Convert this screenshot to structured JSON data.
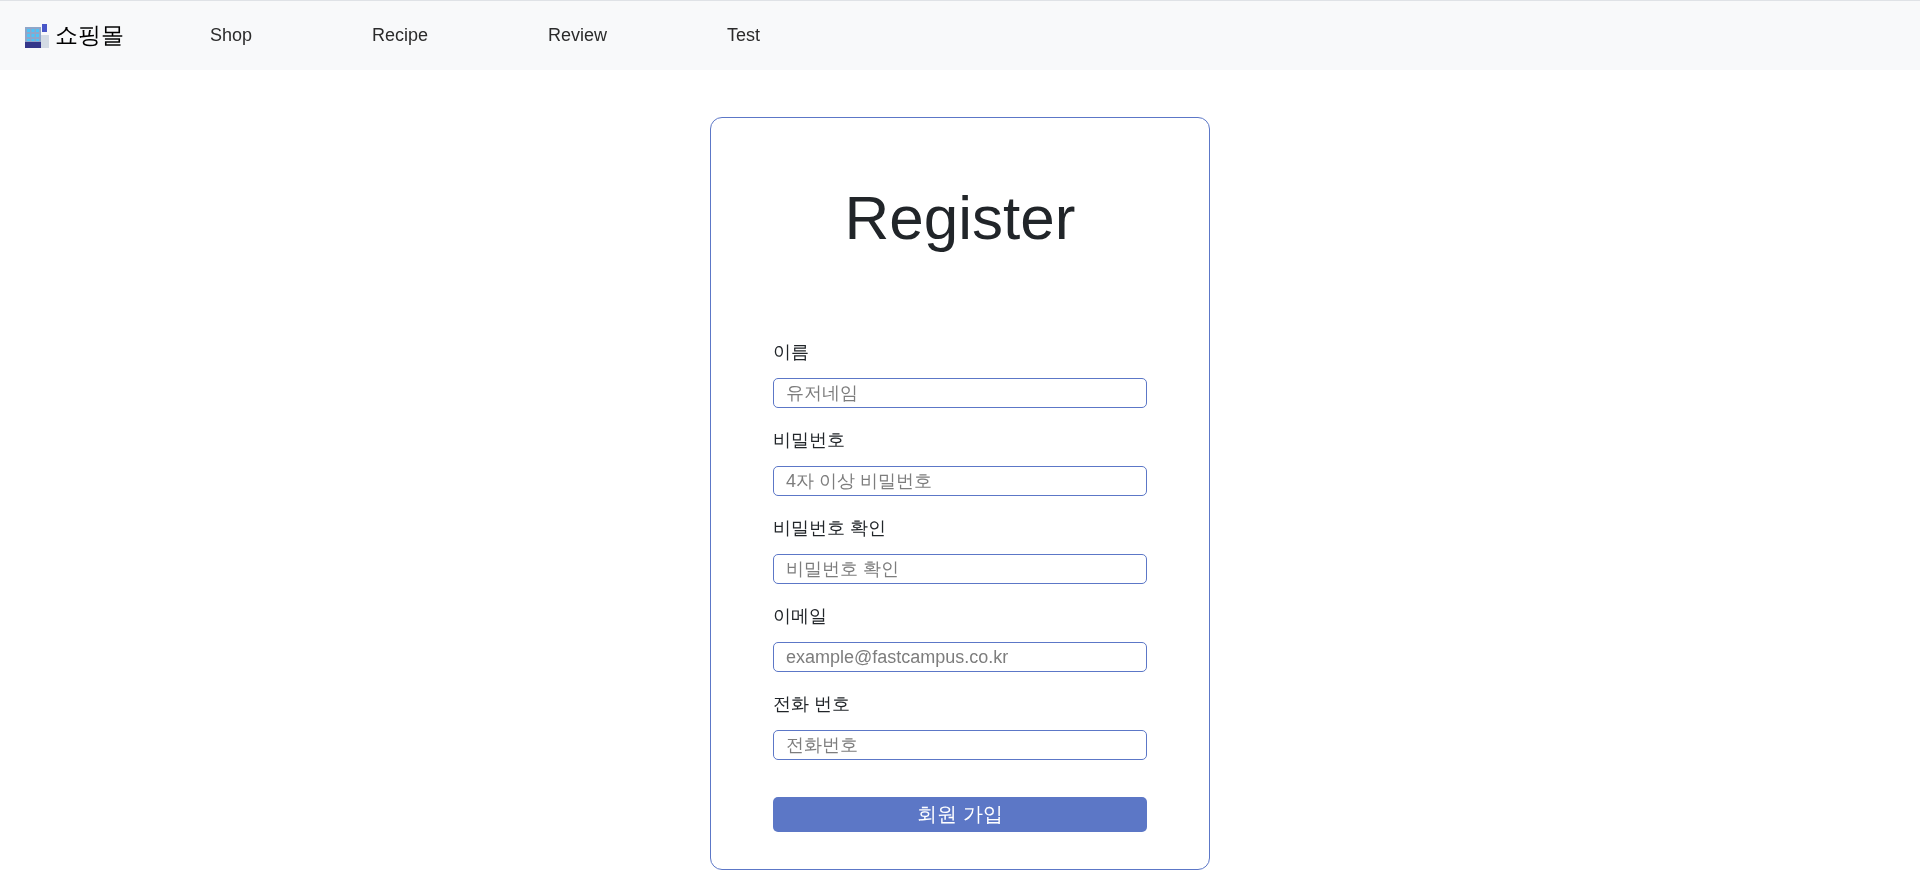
{
  "navbar": {
    "brand": "쇼핑몰",
    "links": [
      "Shop",
      "Recipe",
      "Review",
      "Test"
    ]
  },
  "form": {
    "title": "Register",
    "fields": [
      {
        "label": "이름",
        "placeholder": "유저네임"
      },
      {
        "label": "비밀번호",
        "placeholder": "4자 이상 비밀번호"
      },
      {
        "label": "비밀번호 확인",
        "placeholder": "비밀번호 확인"
      },
      {
        "label": "이메일",
        "placeholder": "example@fastcampus.co.kr"
      },
      {
        "label": "전화 번호",
        "placeholder": "전화번호"
      }
    ],
    "submit": "회원 가입"
  }
}
